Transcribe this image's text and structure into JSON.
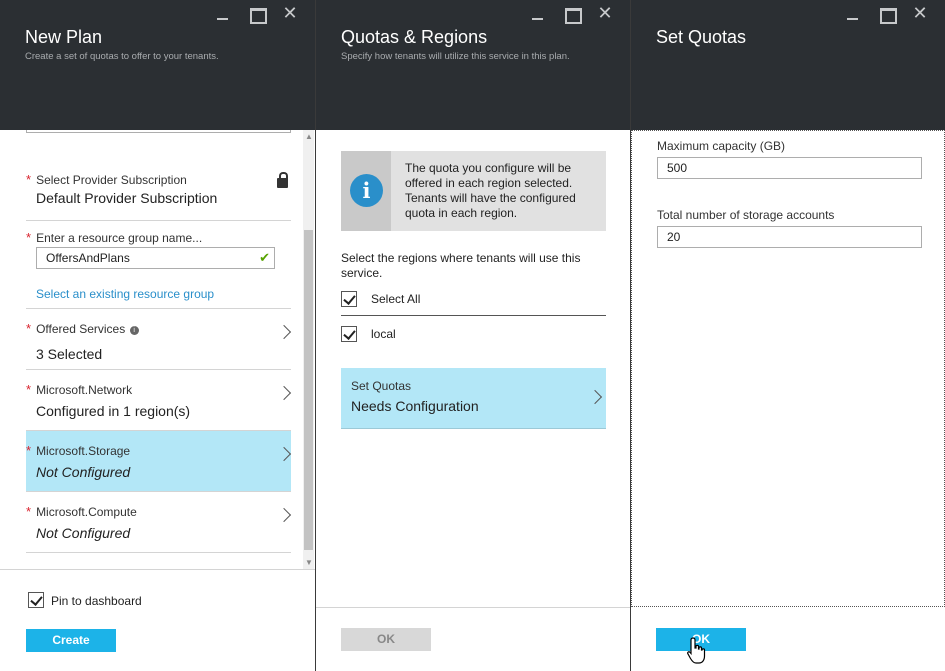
{
  "new_plan": {
    "title": "New Plan",
    "subtitle": "Create a set of quotas to offer to your tenants.",
    "provider_subscription": {
      "label": "Select Provider Subscription",
      "value": "Default Provider Subscription"
    },
    "resource_group": {
      "label": "Enter a resource group name...",
      "value": "OffersAndPlans",
      "link": "Select an existing resource group"
    },
    "offered_services": {
      "label": "Offered Services",
      "value": "3 Selected"
    },
    "network": {
      "label": "Microsoft.Network",
      "value": "Configured in 1 region(s)"
    },
    "storage": {
      "label": "Microsoft.Storage",
      "value": "Not Configured"
    },
    "compute": {
      "label": "Microsoft.Compute",
      "value": "Not Configured"
    },
    "pin_label": "Pin to dashboard",
    "create_label": "Create"
  },
  "quotas_regions": {
    "title": "Quotas & Regions",
    "subtitle": "Specify how tenants will utilize this service in this plan.",
    "info_text": "The quota you configure will be offered in each region selected. Tenants will have the configured quota in each region.",
    "prompt": "Select the regions where tenants will use this service.",
    "select_all": "Select All",
    "region": "local",
    "set_quotas": {
      "label": "Set Quotas",
      "value": "Needs Configuration"
    },
    "ok_label": "OK"
  },
  "set_quotas": {
    "title": "Set Quotas",
    "max_capacity": {
      "label": "Maximum capacity (GB)",
      "value": "500"
    },
    "storage_accounts": {
      "label": "Total number of storage accounts",
      "value": "20"
    },
    "ok_label": "OK"
  },
  "colors": {
    "header": "#2b2f33",
    "accent": "#1cb3e8",
    "selected": "#b3e7f7",
    "required": "#d9232e",
    "link": "#2a8fca"
  }
}
